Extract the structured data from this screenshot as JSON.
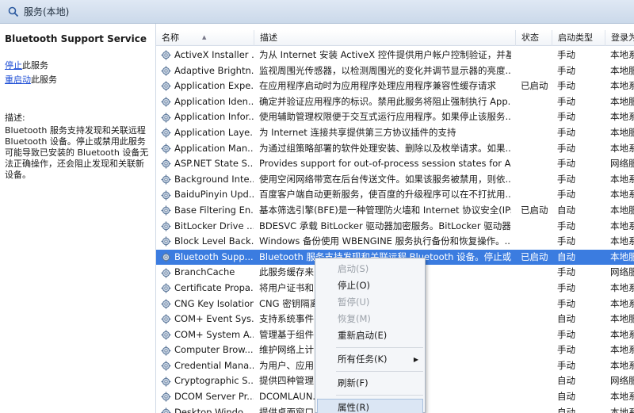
{
  "window": {
    "title": "服务(本地)"
  },
  "left": {
    "service_name": "Bluetooth Support Service",
    "actions": [
      {
        "link": "停止",
        "text": "此服务"
      },
      {
        "link": "重启动",
        "text": "此服务"
      }
    ],
    "desc_label": "描述:",
    "description": "Bluetooth 服务支持发现和关联远程 Bluetooth 设备。停止或禁用此服务可能导致已安装的 Bluetooth 设备无法正确操作，还会阻止发现和关联新设备。"
  },
  "columns": {
    "name": "名称",
    "desc": "描述",
    "status": "状态",
    "startup": "启动类型",
    "logon": "登录为"
  },
  "rows": [
    {
      "name": "ActiveX Installer ...",
      "desc": "为从 Internet 安装 ActiveX 控件提供用户帐户控制验证，并基...",
      "status": "",
      "startup": "手动",
      "logon": "本地系"
    },
    {
      "name": "Adaptive Brightn...",
      "desc": "监视周围光传感器，以检测周围光的变化并调节显示器的亮度...",
      "status": "",
      "startup": "手动",
      "logon": "本地服"
    },
    {
      "name": "Application Expe...",
      "desc": "在应用程序启动时为应用程序处理应用程序兼容性缓存请求",
      "status": "已启动",
      "startup": "手动",
      "logon": "本地系"
    },
    {
      "name": "Application Iden...",
      "desc": "确定并验证应用程序的标识。禁用此服务将阻止强制执行 App...",
      "status": "",
      "startup": "手动",
      "logon": "本地服"
    },
    {
      "name": "Application Infor...",
      "desc": "使用辅助管理权限便于交互式运行应用程序。如果停止该服务...",
      "status": "",
      "startup": "手动",
      "logon": "本地系"
    },
    {
      "name": "Application Laye...",
      "desc": "为 Internet 连接共享提供第三方协议插件的支持",
      "status": "",
      "startup": "手动",
      "logon": "本地服"
    },
    {
      "name": "Application Man...",
      "desc": "为通过组策略部署的软件处理安装、删除以及枚举请求。如果...",
      "status": "",
      "startup": "手动",
      "logon": "本地系"
    },
    {
      "name": "ASP.NET State S...",
      "desc": "Provides support for out-of-process session states for A...",
      "status": "",
      "startup": "手动",
      "logon": "网络服"
    },
    {
      "name": "Background Inte...",
      "desc": "使用空闲网络带宽在后台传送文件。如果该服务被禁用，则依...",
      "status": "",
      "startup": "手动",
      "logon": "本地系"
    },
    {
      "name": "BaiduPinyin Upd...",
      "desc": "百度客户端自动更新服务，使百度的升级程序可以在不打扰用...",
      "status": "",
      "startup": "手动",
      "logon": "本地系"
    },
    {
      "name": "Base Filtering En...",
      "desc": "基本筛选引擎(BFE)是一种管理防火墙和 Internet 协议安全(IPs...",
      "status": "已启动",
      "startup": "自动",
      "logon": "本地服"
    },
    {
      "name": "BitLocker Drive ...",
      "desc": "BDESVC 承载 BitLocker 驱动器加密服务。BitLocker 驱动器...",
      "status": "",
      "startup": "手动",
      "logon": "本地系"
    },
    {
      "name": "Block Level Back...",
      "desc": "Windows 备份使用 WBENGINE 服务执行备份和恢复操作。...",
      "status": "",
      "startup": "手动",
      "logon": "本地系"
    },
    {
      "name": "Bluetooth Supp...",
      "desc": "Bluetooth 服务支持发现和关联远程 Bluetooth 设备。停止或...",
      "status": "已启动",
      "startup": "自动",
      "logon": "本地服"
    },
    {
      "name": "BranchCache",
      "desc": "此服务缓存来自...",
      "status": "",
      "startup": "手动",
      "logon": "网络服"
    },
    {
      "name": "Certificate Propa...",
      "desc": "将用户证书和...",
      "status": "",
      "startup": "手动",
      "logon": "本地系"
    },
    {
      "name": "CNG Key Isolation",
      "desc": "CNG 密钥隔离...",
      "status": "",
      "startup": "手动",
      "logon": "本地系"
    },
    {
      "name": "COM+ Event Sys...",
      "desc": "支持系统事件...",
      "status": "",
      "startup": "自动",
      "logon": "本地服"
    },
    {
      "name": "COM+ System A...",
      "desc": "管理基于组件...",
      "status": "",
      "startup": "手动",
      "logon": "本地系"
    },
    {
      "name": "Computer Brow...",
      "desc": "维护网络上计...",
      "status": "",
      "startup": "手动",
      "logon": "本地系"
    },
    {
      "name": "Credential Mana...",
      "desc": "为用户、应用...",
      "status": "",
      "startup": "手动",
      "logon": "本地系"
    },
    {
      "name": "Cryptographic S...",
      "desc": "提供四种管理...",
      "status": "",
      "startup": "自动",
      "logon": "网络服"
    },
    {
      "name": "DCOM Server Pr...",
      "desc": "DCOMLAUN...",
      "status": "",
      "startup": "自动",
      "logon": "本地系"
    },
    {
      "name": "Desktop Windo...",
      "desc": "提供桌面窗口...",
      "status": "",
      "startup": "自动",
      "logon": "本地系"
    }
  ],
  "context_menu": {
    "items": [
      {
        "label": "启动(S)",
        "disabled": true
      },
      {
        "label": "停止(O)",
        "disabled": false
      },
      {
        "label": "暂停(U)",
        "disabled": true
      },
      {
        "label": "恢复(M)",
        "disabled": true
      },
      {
        "label": "重新启动(E)",
        "disabled": false
      },
      {
        "label": "所有任务(K)",
        "disabled": false,
        "submenu": true
      },
      {
        "label": "刷新(F)",
        "disabled": false
      },
      {
        "label": "属性(R)",
        "disabled": false
      }
    ]
  },
  "colors": {
    "selection": "#3b7ce0",
    "link": "#1f4fd6"
  }
}
